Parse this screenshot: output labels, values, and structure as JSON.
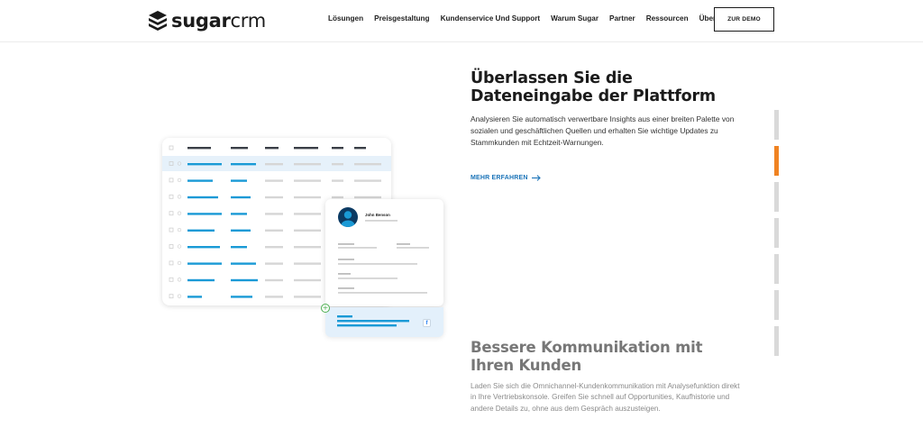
{
  "header": {
    "logo_text_bold": "sugar",
    "logo_text_light": "crm",
    "nav": [
      "Lösungen",
      "Preisgestaltung",
      "Kundenservice Und Support",
      "Warum Sugar",
      "Partner",
      "Ressourcen",
      "Über"
    ],
    "demo_label": "ZUR DEMO"
  },
  "illustration": {
    "contact_name": "John Benson",
    "facebook_glyph": "f",
    "plus_glyph": "+"
  },
  "section1": {
    "title": "Überlassen Sie die Dateneingabe der Plattform",
    "body": "Analysieren Sie automatisch verwertbare Insights aus einer breiten Palette von sozialen und geschäftlichen Quellen und erhalten Sie wichtige Updates zu Stammkunden mit Echtzeit-Warnungen.",
    "link": "MEHR ERFAHREN"
  },
  "section2": {
    "title": "Bessere Kommunikation mit Ihren Kunden",
    "body": "Laden Sie sich die Omnichannel-Kundenkommunikation mit Analysefunktion direkt in Ihre Vertriebskonsole. Greifen Sie schnell auf Opportunities, Kaufhistorie und andere Details zu, ohne aus dem Gespräch auszusteigen."
  },
  "indicators": {
    "count": 7,
    "active_index": 1
  },
  "colors": {
    "accent_blue": "#1a9ad6",
    "link_blue": "#1a73b8",
    "active_indicator": "#f08322",
    "navy": "#0b3a63"
  }
}
